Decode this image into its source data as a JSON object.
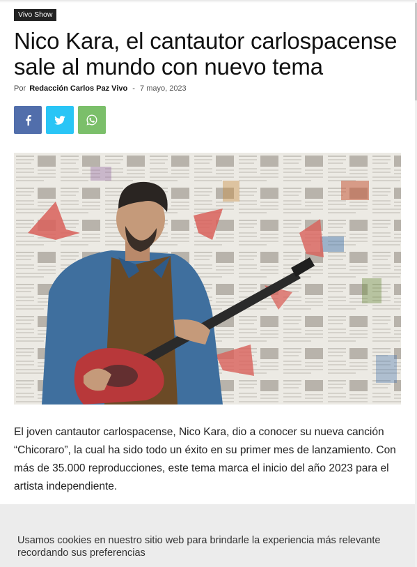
{
  "article": {
    "category": "Vivo Show",
    "title": "Nico Kara, el cantautor carlospacense sale al mundo con nuevo tema",
    "byline_prefix": "Por",
    "author": "Redacción Carlos Paz Vivo",
    "separator": "-",
    "date": "7 mayo, 2023",
    "paragraph": "El joven cantautor carlospacense, Nico Kara, dio a conocer su nueva canción “Chicoraro”, la cual ha sido todo un éxito en su primer mes de lanzamiento. Con más de 35.000 reproducciones, este tema marca el inicio del año 2023 para el artista independiente."
  },
  "share": {
    "buttons": [
      {
        "network": "facebook",
        "icon": "facebook-icon",
        "color": "#516eab"
      },
      {
        "network": "twitter",
        "icon": "twitter-icon",
        "color": "#29c5f6"
      },
      {
        "network": "whatsapp",
        "icon": "whatsapp-icon",
        "color": "#7bbf6a"
      }
    ]
  },
  "cookie_banner": {
    "text": "Usamos cookies en nuestro sitio web para brindarle la experiencia más relevante recordando sus preferencias"
  },
  "colors": {
    "category_bg": "#222222",
    "cookie_bg": "#ececec"
  }
}
